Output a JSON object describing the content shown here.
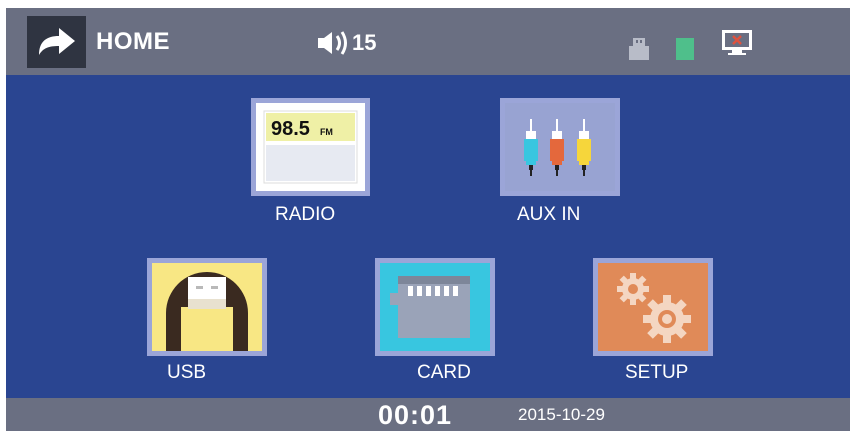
{
  "header": {
    "title": "HOME",
    "volume_value": "15",
    "icons": [
      "back-arrow-icon",
      "speaker-icon",
      "usb-status-icon",
      "sd-card-status-icon",
      "screen-off-icon"
    ]
  },
  "menu": {
    "radio": {
      "label": "RADIO",
      "frequency": "98.5",
      "band": "FM"
    },
    "aux": {
      "label": "AUX IN"
    },
    "usb": {
      "label": "USB"
    },
    "card": {
      "label": "CARD"
    },
    "setup": {
      "label": "SETUP"
    }
  },
  "footer": {
    "clock": "00:01",
    "date": "2015-10-29"
  },
  "colors": {
    "background_blue": "#2a4591",
    "bar_gray": "#6a6f82",
    "tile_border": "#9ba5d8",
    "usb_yellow": "#f8e784",
    "card_cyan": "#38c6e0",
    "setup_orange": "#e08a58",
    "status_green": "#4fbf8b"
  }
}
